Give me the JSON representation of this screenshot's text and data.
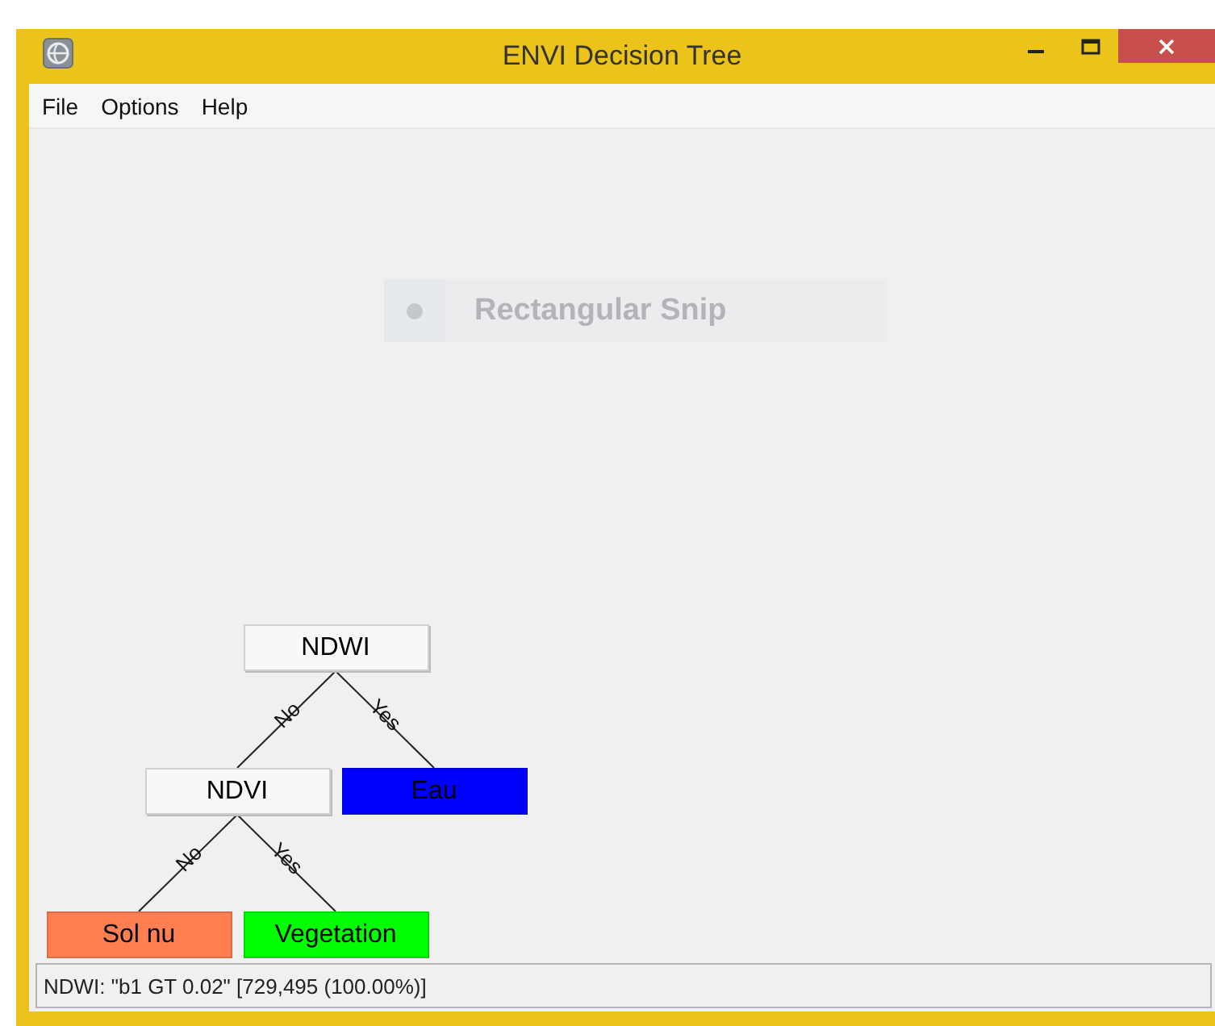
{
  "window": {
    "title": "ENVI Decision Tree"
  },
  "menu": [
    {
      "label": "File"
    },
    {
      "label": "Options"
    },
    {
      "label": "Help"
    }
  ],
  "snip_overlay": {
    "label": "Rectangular Snip"
  },
  "tree": {
    "label": "NDWI",
    "kind": "decision",
    "children": [
      {
        "edge": "No",
        "label": "NDVI",
        "kind": "decision",
        "children": [
          {
            "edge": "No",
            "label": "Sol nu",
            "kind": "class",
            "color": "#ff7f50"
          },
          {
            "edge": "Yes",
            "label": "Vegetation",
            "kind": "class",
            "color": "#00ff00"
          }
        ]
      },
      {
        "edge": "Yes",
        "label": "Eau",
        "kind": "class",
        "color": "#0000ff"
      }
    ]
  },
  "status_bar": "NDWI: \"b1 GT 0.02\" [729,495 (100.00%)]"
}
